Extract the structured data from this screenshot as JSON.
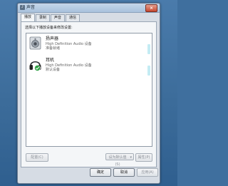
{
  "window": {
    "title": "声音"
  },
  "tabs": [
    {
      "label": "播放",
      "active": true
    },
    {
      "label": "录制",
      "active": false
    },
    {
      "label": "声音",
      "active": false
    },
    {
      "label": "通信",
      "active": false
    }
  ],
  "panel": {
    "instruction": "选择以下播放设备来修改设置:"
  },
  "devices": [
    {
      "name": "扬声器",
      "driver": "High Definition Audio 设备",
      "status": "准备就绪",
      "icon": "speaker-icon"
    },
    {
      "name": "耳机",
      "driver": "High Definition Audio 设备",
      "status": "默认设备",
      "icon": "headphones-icon",
      "default": true
    }
  ],
  "buttons": {
    "configure": "配置(C)",
    "set_default": "设为默认值(S)",
    "properties": "属性(P)"
  },
  "footer": {
    "ok": "确定",
    "cancel": "取消",
    "apply": "应用(A)"
  },
  "colors": {
    "accent_check": "#2ea043",
    "titlebar": "#b7cce3",
    "close": "#c6472f"
  }
}
